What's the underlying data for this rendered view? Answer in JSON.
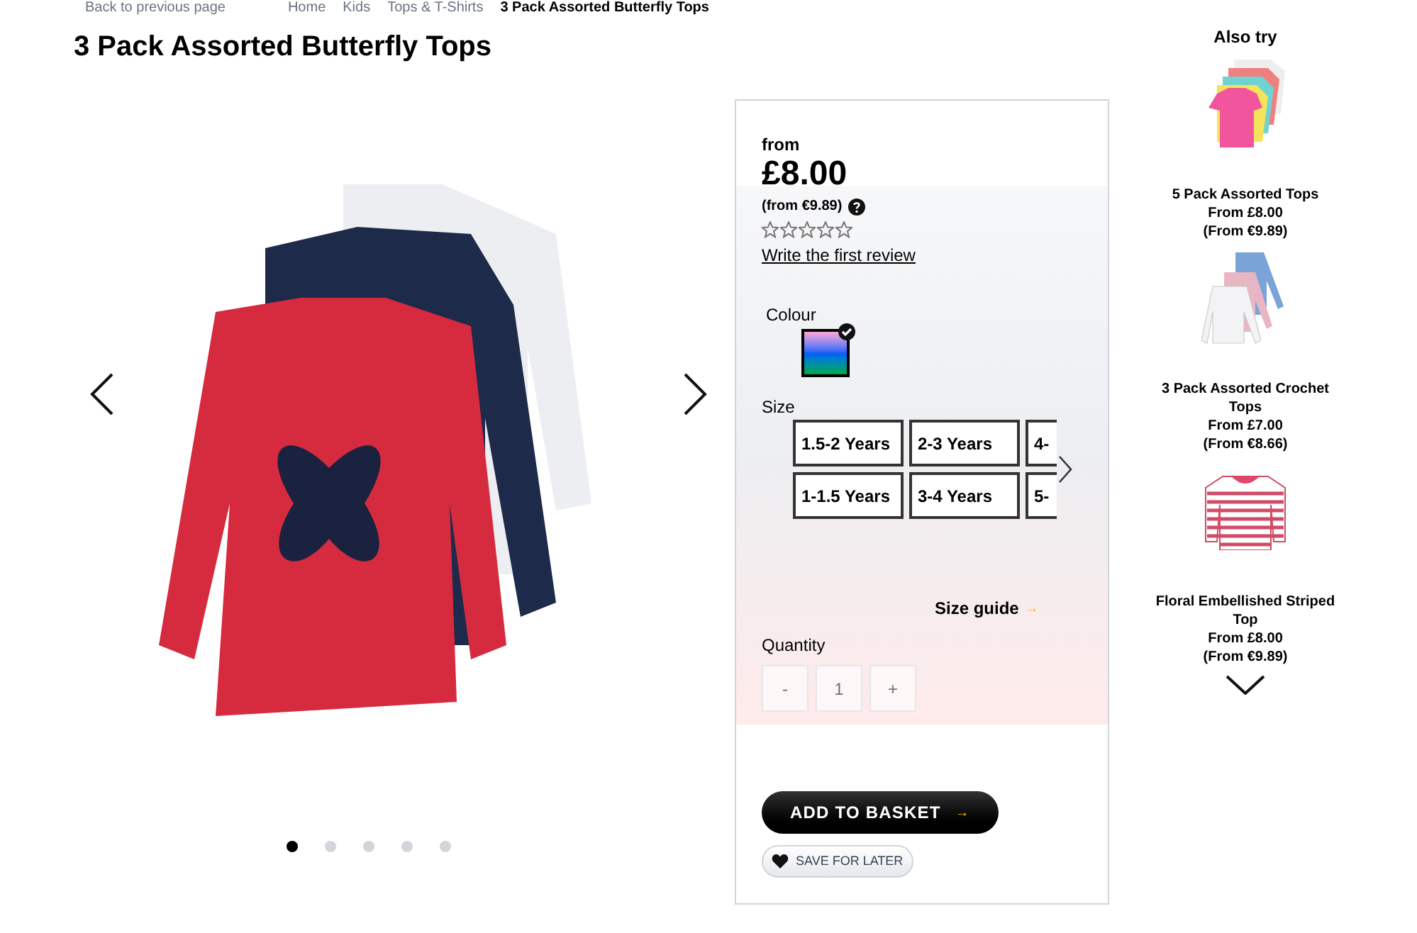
{
  "breadcrumb": {
    "back": "Back to previous page",
    "items": [
      "Home",
      "Kids",
      "Tops & T-Shirts",
      "3 Pack Assorted Butterfly Tops"
    ]
  },
  "title": "3 Pack Assorted Butterfly Tops",
  "gallery": {
    "dots": [
      {
        "selected": true
      },
      {
        "selected": false
      },
      {
        "selected": false
      },
      {
        "selected": false
      },
      {
        "selected": false
      }
    ]
  },
  "panel": {
    "from_label": "from",
    "price": "£8.00",
    "alt_price": "(from €9.89)",
    "stars": 0,
    "review_link": "Write the first review",
    "colour_label": "Colour",
    "swatches": [
      {
        "selected": true
      }
    ],
    "size_label": "Size",
    "sizes": [
      {
        "label": "1.5-2 Years"
      },
      {
        "label": "2-3 Years"
      },
      {
        "label": "4-"
      },
      {
        "label": "1-1.5 Years"
      },
      {
        "label": "3-4 Years"
      },
      {
        "label": "5-"
      }
    ],
    "size_guide": "Size guide",
    "arrow_glyph": "→",
    "quantity_label": "Quantity",
    "quantity": {
      "minus": "-",
      "value": "1",
      "plus": "+",
      "disabled": true
    },
    "add_button": "ADD TO BASKET",
    "save_button": "SAVE FOR LATER"
  },
  "also_try": {
    "title": "Also try",
    "items": [
      {
        "kind": "tees",
        "name": "5 Pack Assorted Tops",
        "price": "From £8.00",
        "alt_price": "(From €9.89)"
      },
      {
        "kind": "longsleeves",
        "name": "3 Pack Assorted Crochet Tops",
        "price": "From £7.00",
        "alt_price": "(From €8.66)"
      },
      {
        "kind": "striped",
        "name": "Floral Embellished Striped Top",
        "price": "From £8.00",
        "alt_price": "(From €9.89)"
      }
    ]
  }
}
